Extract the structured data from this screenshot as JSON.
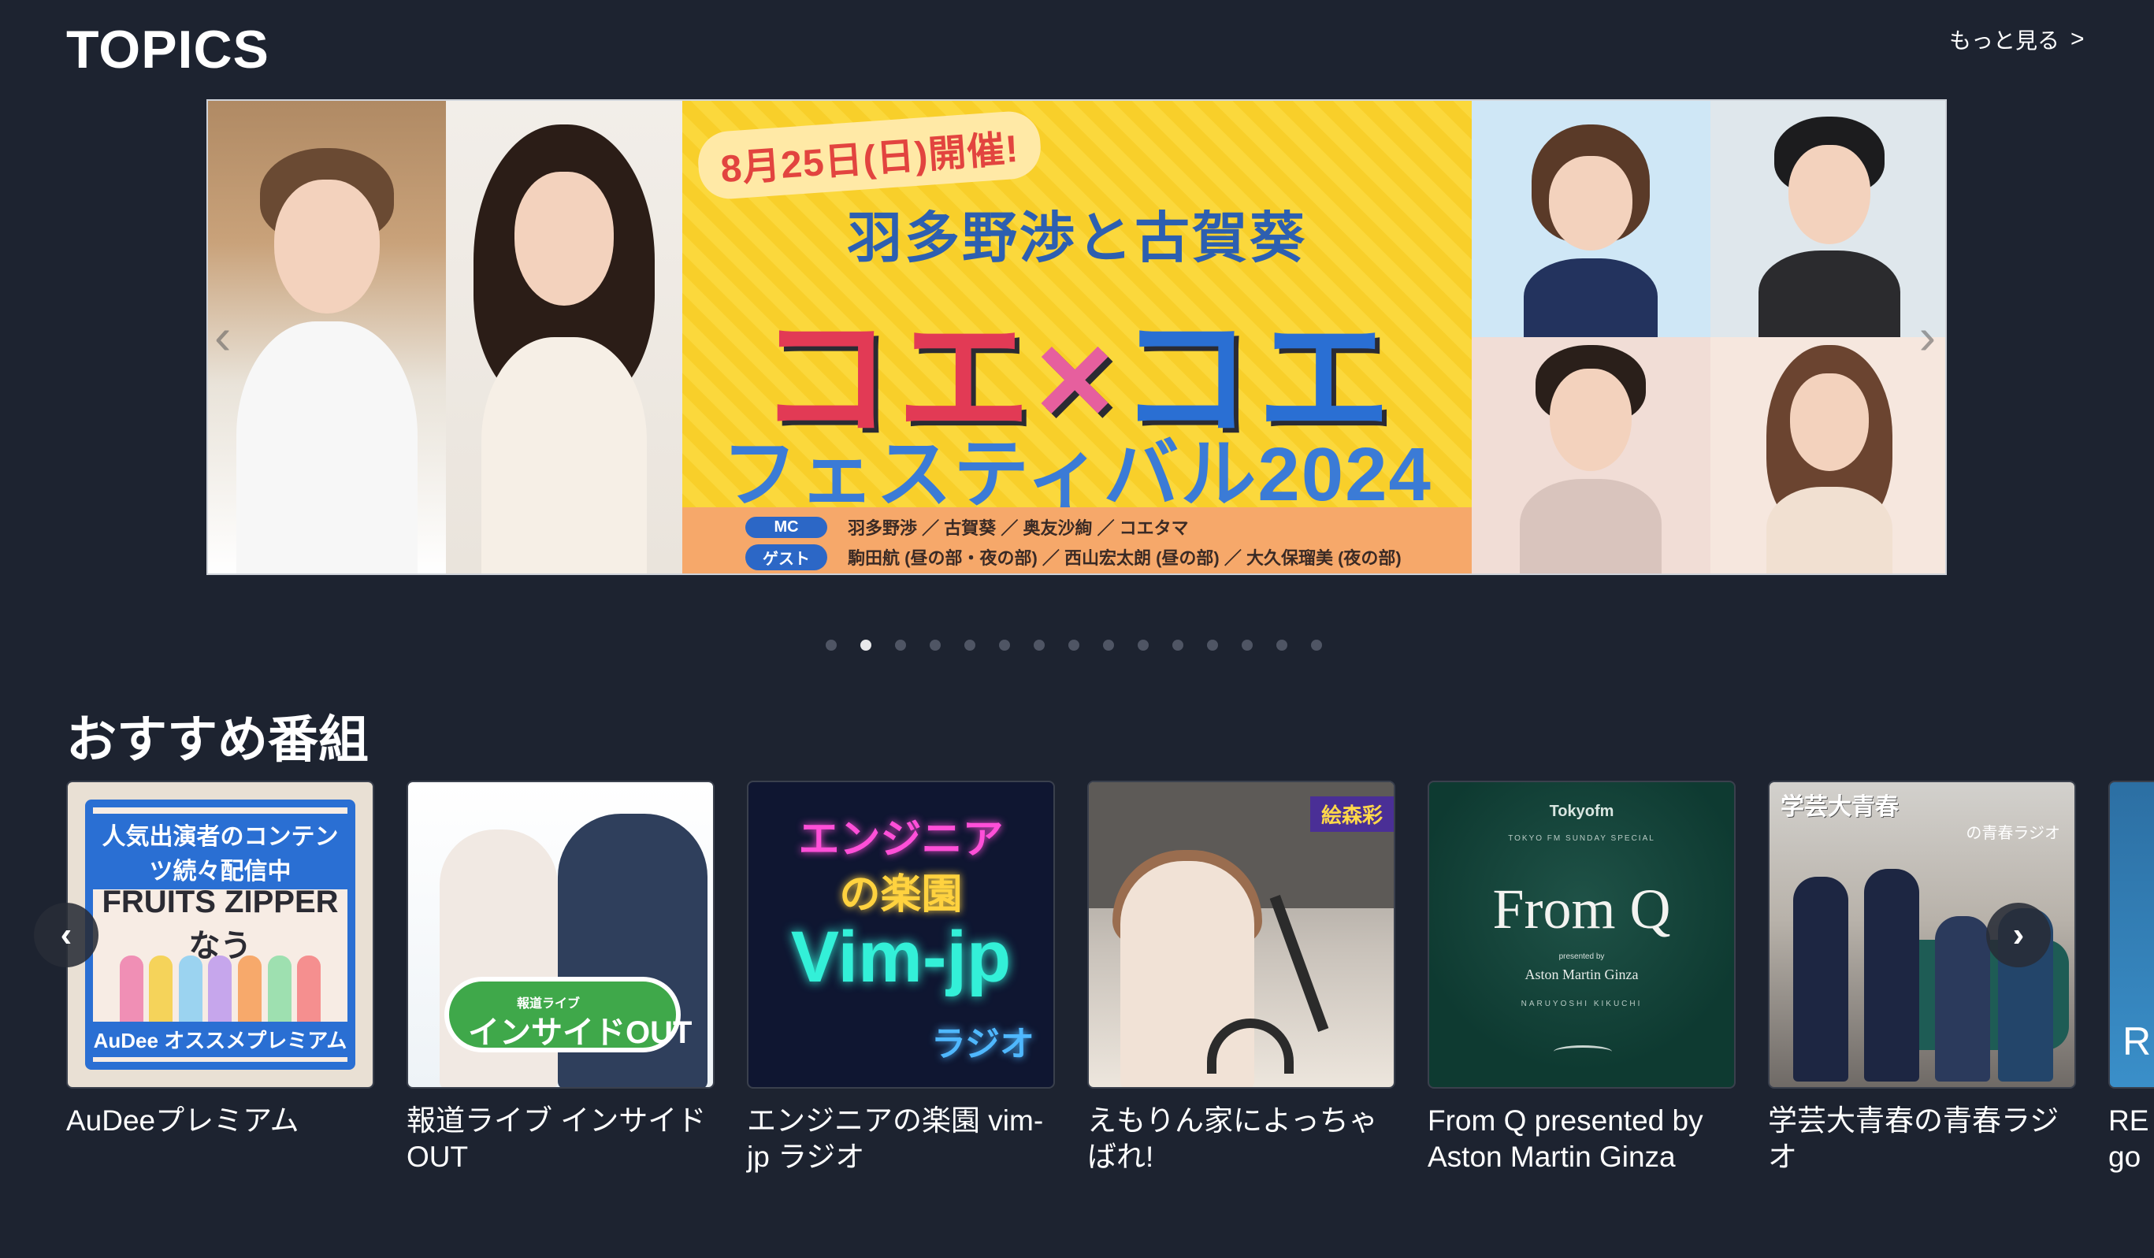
{
  "header": {
    "title": "TOPICS",
    "more_label": "もっと見る",
    "more_chevron": ">"
  },
  "banner": {
    "date": "8月25日(日)開催!",
    "subtitle": "羽多野渉と古賀葵",
    "main_left": "コエ",
    "main_x": "×",
    "main_right": "コエ",
    "festival": "フェスティバル2024",
    "mc_tag": "MC",
    "mc_names": "羽多野渉 ／ 古賀葵 ／ 奥友沙絢 ／ コエタマ",
    "guest_tag": "ゲスト",
    "guest_names": "駒田航 (昼の部・夜の部) ／ 西山宏太朗 (昼の部) ／ 大久保瑠美 (夜の部)",
    "prev_arrow": "‹",
    "next_arrow": "›"
  },
  "pagination": {
    "count": 15,
    "active_index": 1
  },
  "recommended": {
    "title": "おすすめ番組",
    "prev_button": "‹",
    "next_button": "›",
    "cards": [
      {
        "title": "AuDeeプレミアム",
        "art": {
          "top": "人気出演者のコンテンツ続々配信中",
          "logo": "FRUITS ZIPPER なう",
          "bottom": "AuDee オススメプレミアム"
        }
      },
      {
        "title": "報道ライブ インサイドOUT",
        "art": {
          "small": "報道ライブ",
          "main": "インサイドOUT"
        }
      },
      {
        "title": "エンジニアの楽園 vim-jp ラジオ",
        "art": {
          "line1": "エンジニア",
          "line2": "の楽園",
          "line3": "Vim-jp",
          "line4": "ラジオ"
        }
      },
      {
        "title": "えもりん家によっちゃばれ!",
        "art": {
          "badge": "絵森彩"
        }
      },
      {
        "title": "From Q presented by Aston Martin Ginza",
        "art": {
          "brand": "Tokyofm",
          "small": "TOKYO FM SUNDAY SPECIAL",
          "logo": "From Q",
          "presented": "presented by",
          "aston": "Aston Martin Ginza",
          "name": "NARUYOSHI KIKUCHI"
        }
      },
      {
        "title": "学芸大青春の青春ラジオ",
        "art": {
          "label": "学芸大青春",
          "label2": "の青春ラジオ"
        }
      },
      {
        "title": "RE",
        "title2": "go",
        "art": {
          "glyph": "R"
        }
      }
    ]
  },
  "colors": {
    "background": "#1d2330",
    "dot_inactive": "#4f5564",
    "dot_active": "#e8e8ea",
    "banner_yellow": "#fbd83c",
    "accent_blue": "#2a6fd3",
    "accent_red": "#e23a55"
  },
  "icons": {
    "more_chevron": "chevron-right-icon",
    "carousel_prev": "chevron-left-icon",
    "carousel_next": "chevron-right-icon"
  }
}
